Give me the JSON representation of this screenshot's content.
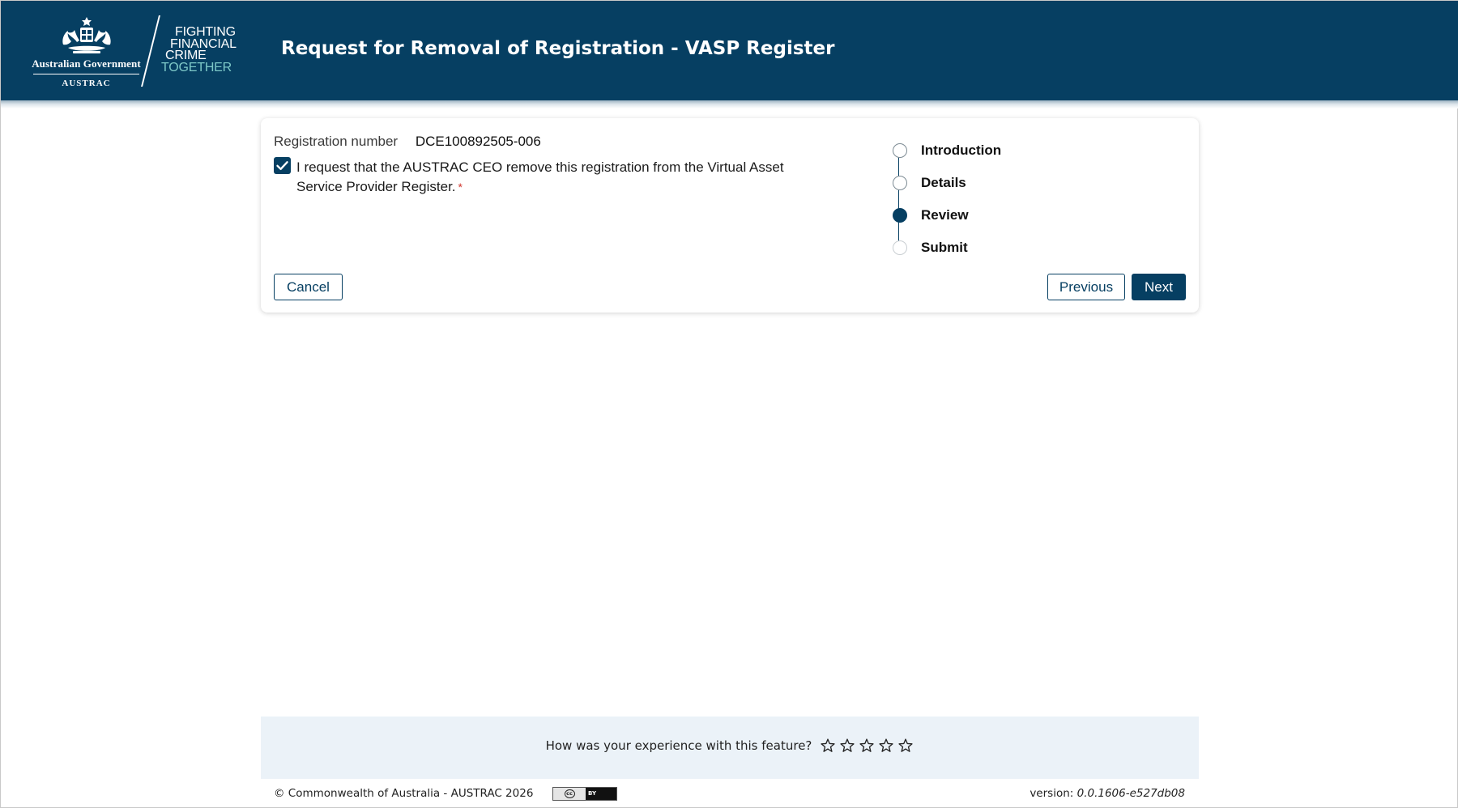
{
  "header": {
    "gov_name": "Australian Government",
    "agency": "AUSTRAC",
    "tagline": [
      "FIGHTING",
      "FINANCIAL",
      "CRIME",
      "TOGETHER"
    ],
    "page_title": "Request for Removal of Registration - VASP Register",
    "background_color": "#063f62"
  },
  "form": {
    "registration_label": "Registration number",
    "registration_number": "DCE100892505-006",
    "request_checked": true,
    "request_text": "I request that the AUSTRAC CEO remove this registration from the Virtual Asset Service Provider Register.",
    "required_marker": "*"
  },
  "stepper": {
    "steps": [
      {
        "label": "Introduction",
        "state": "complete"
      },
      {
        "label": "Details",
        "state": "complete"
      },
      {
        "label": "Review",
        "state": "active"
      },
      {
        "label": "Submit",
        "state": "upcoming"
      }
    ]
  },
  "buttons": {
    "cancel": "Cancel",
    "previous": "Previous",
    "next": "Next"
  },
  "feedback": {
    "question": "How was your experience with this feature?",
    "star_count": 5,
    "rating": 0
  },
  "footer": {
    "copyright": "© Commonwealth of Australia - AUSTRAC 2026",
    "license_badge": {
      "left": "cc",
      "right": "BY"
    },
    "version_label": "version:",
    "version_number": "0.0.1606-e527db08"
  },
  "colors": {
    "primary": "#063f62",
    "feedback_bg": "#ebf2f8",
    "required": "#d0332b",
    "tagline_accent": "#7ec9c8"
  }
}
